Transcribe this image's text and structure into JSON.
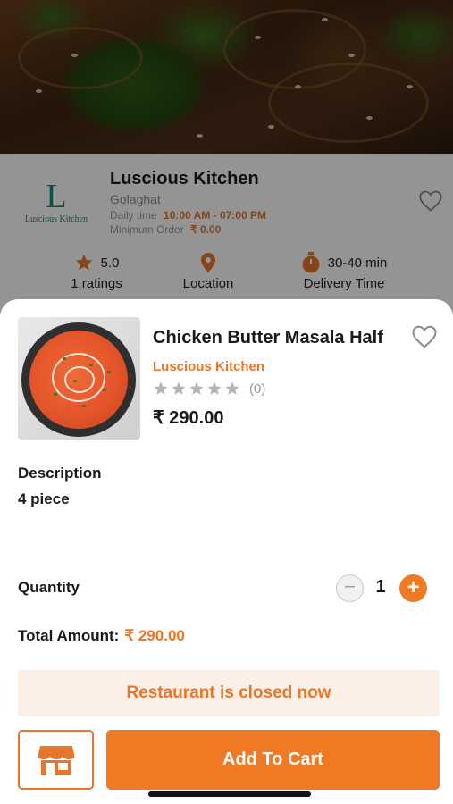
{
  "restaurant": {
    "logo_letter": "L",
    "logo_text": "Luscious Kitchen",
    "name": "Luscious Kitchen",
    "location": "Golaghat",
    "daily_time_label": "Daily time",
    "daily_time_value": "10:00 AM - 07:00 PM",
    "min_order_label": "Minimum Order",
    "min_order_value": "₹ 0.00",
    "rating_value": "5.0",
    "rating_label": "1 ratings",
    "location_label": "Location",
    "delivery_value": "30-40 min",
    "delivery_label": "Delivery Time"
  },
  "dish": {
    "title": "Chicken Butter Masala Half",
    "restaurant": "Luscious Kitchen",
    "rating_stars": 0,
    "rating_count": "(0)",
    "price": "₹ 290.00"
  },
  "description": {
    "heading": "Description",
    "value": "4 piece"
  },
  "quantity": {
    "label": "Quantity",
    "minus": "−",
    "value": "1",
    "plus": "+"
  },
  "total": {
    "label": "Total Amount:",
    "value": "₹ 290.00"
  },
  "notice": "Restaurant is closed now",
  "actions": {
    "add_to_cart": "Add To Cart"
  },
  "colors": {
    "accent": "#ef7a23",
    "accent_text": "#e8762a",
    "notice_bg": "#fcefe6",
    "logo": "#1b8a86"
  },
  "icons": {
    "rest_heart": "heart-outline-icon",
    "dish_heart": "heart-outline-icon",
    "rating": "star-icon",
    "location": "map-pin-icon",
    "delivery": "stopwatch-icon",
    "store": "storefront-icon"
  }
}
